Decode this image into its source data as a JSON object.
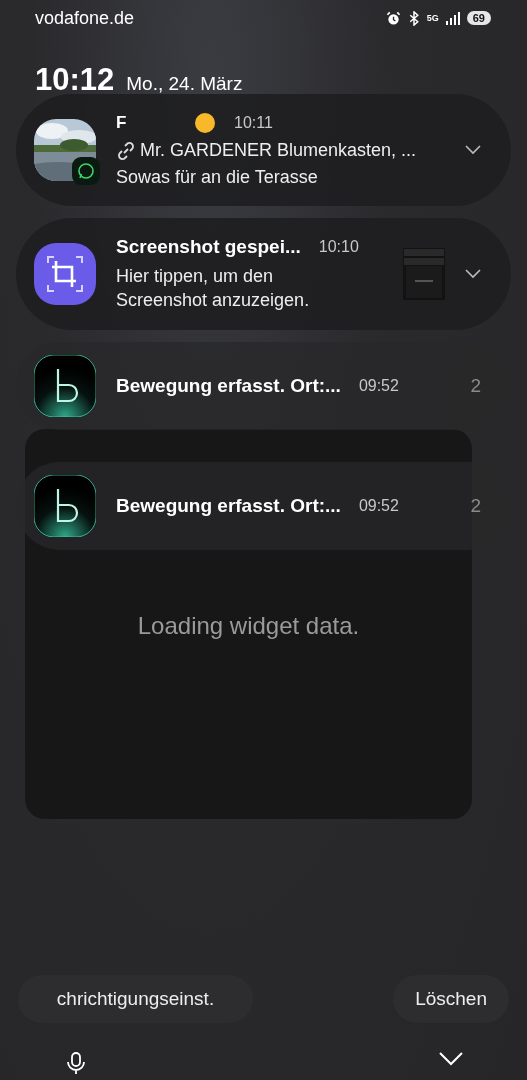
{
  "status_bar": {
    "carrier": "vodafone.de",
    "network": "5G",
    "battery": "69"
  },
  "clock": {
    "time": "10:12",
    "date": "Mo., 24. März"
  },
  "notifications": [
    {
      "kind": "message",
      "sender": "F",
      "time": "10:11",
      "title": "Mr. GARDENER Blumenkasten, ...",
      "text": "Sowas für an die Terasse",
      "expandable": true
    },
    {
      "kind": "screenshot",
      "title": "Screenshot gespei...",
      "time": "10:10",
      "text": "Hier tippen, um den Screenshot anzuzeigen.",
      "expandable": true
    },
    {
      "kind": "camera",
      "title": "Bewegung erfasst. Ort:...",
      "time": "09:52",
      "count": "2",
      "expandable": false
    },
    {
      "kind": "camera",
      "title": "Bewegung erfasst. Ort:...",
      "time": "09:52",
      "count": "2",
      "expandable": false
    }
  ],
  "widget": {
    "message": "Loading widget data."
  },
  "buttons": [
    {
      "label": "chrichtigungseinst."
    },
    {
      "label": "Löschen"
    }
  ]
}
